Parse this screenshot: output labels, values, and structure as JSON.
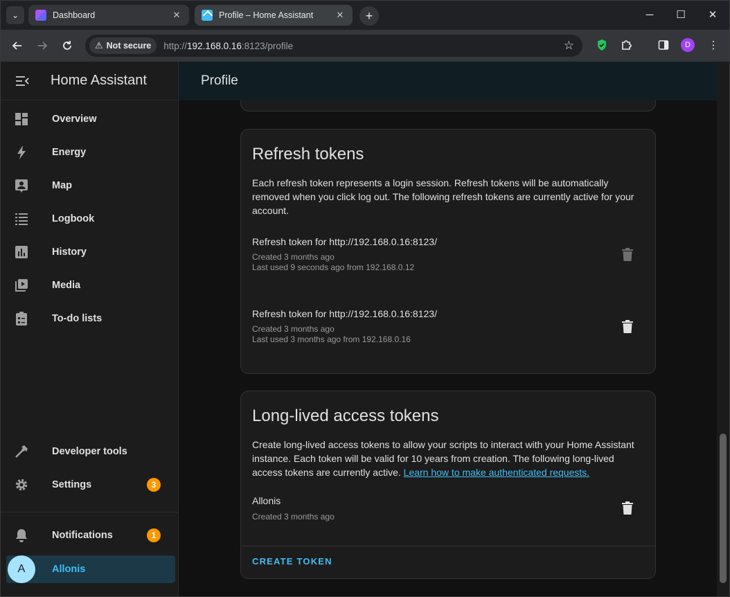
{
  "browser": {
    "tabs": [
      {
        "title": "Dashboard",
        "active": false
      },
      {
        "title": "Profile – Home Assistant",
        "active": true
      }
    ],
    "address": {
      "security_label": "Not secure",
      "url_prefix": "http://",
      "url_host": "192.168.0.16",
      "url_rest": ":8123/profile"
    },
    "profile_initial": "D"
  },
  "sidebar": {
    "title": "Home Assistant",
    "items": [
      {
        "label": "Overview",
        "icon": "dashboard-icon"
      },
      {
        "label": "Energy",
        "icon": "lightning-icon"
      },
      {
        "label": "Map",
        "icon": "map-icon"
      },
      {
        "label": "Logbook",
        "icon": "logbook-icon"
      },
      {
        "label": "History",
        "icon": "history-icon"
      },
      {
        "label": "Media",
        "icon": "media-icon"
      },
      {
        "label": "To-do lists",
        "icon": "clipboard-icon"
      }
    ],
    "bottom_items": [
      {
        "label": "Developer tools",
        "icon": "hammer-icon"
      },
      {
        "label": "Settings",
        "icon": "gear-icon",
        "badge": "3"
      }
    ],
    "notifications": {
      "label": "Notifications",
      "badge": "1"
    },
    "user": {
      "name": "Allonis",
      "initial": "A"
    }
  },
  "main": {
    "title": "Profile",
    "refresh_tokens": {
      "heading": "Refresh tokens",
      "description": "Each refresh token represents a login session. Refresh tokens will be automatically removed when you click log out. The following refresh tokens are currently active for your account.",
      "tokens": [
        {
          "name": "Refresh token for http://192.168.0.16:8123/",
          "created": "Created 3 months ago",
          "last_used": "Last used 9 seconds ago from 192.168.0.12"
        },
        {
          "name": "Refresh token for http://192.168.0.16:8123/",
          "created": "Created 3 months ago",
          "last_used": "Last used 3 months ago from 192.168.0.16"
        }
      ]
    },
    "long_lived": {
      "heading": "Long-lived access tokens",
      "description": "Create long-lived access tokens to allow your scripts to interact with your Home Assistant instance. Each token will be valid for 10 years from creation. The following long-lived access tokens are currently active.",
      "link_text": "Learn how to make authenticated requests.",
      "tokens": [
        {
          "name": "Allonis",
          "created": "Created 3 months ago"
        }
      ],
      "create_label": "CREATE TOKEN"
    }
  },
  "colors": {
    "accent": "#41bdf5",
    "badge": "#ff9800",
    "background": "#111111",
    "card": "#1c1c1c"
  }
}
